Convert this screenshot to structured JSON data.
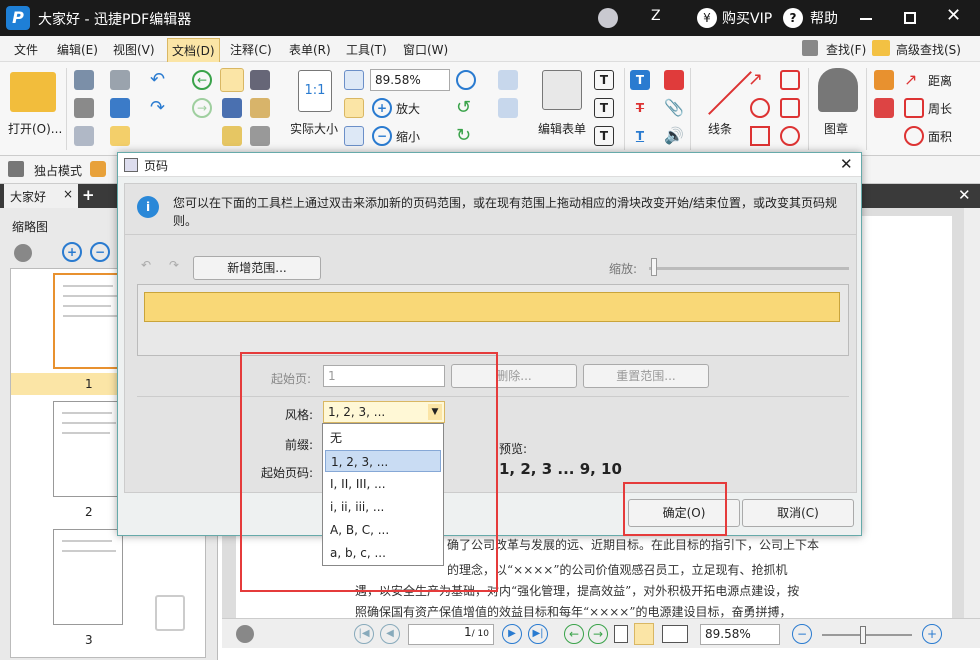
{
  "window": {
    "title": "大家好 - 迅捷PDF编辑器",
    "buy_vip": "购买VIP",
    "help": "帮助",
    "user_initial": "Z"
  },
  "menu": [
    "文件",
    "编辑(E)",
    "视图(V)",
    "文档(D)",
    "注释(C)",
    "表单(R)",
    "工具(T)",
    "窗口(W)"
  ],
  "menu_right": {
    "find": "查找(F)",
    "adv_find": "高级查找(S)"
  },
  "ribbon": {
    "open": "打开(O)...",
    "zoom": "89.58%",
    "actual_size": "实际大小",
    "zoom_in": "放大",
    "zoom_out": "缩小",
    "edit_form": "编辑表单",
    "line": "线条",
    "stamp": "图章",
    "distance": "距离",
    "perimeter": "周长",
    "area": "面积"
  },
  "subbar": {
    "exclusive": "独占模式"
  },
  "tabs": {
    "doc_tab": "大家好"
  },
  "left": {
    "title": "缩略图",
    "pages": [
      "1",
      "2",
      "3"
    ]
  },
  "dialog": {
    "title": "页码",
    "info": "您可以在下面的工具栏上通过双击来添加新的页码范围，或在现有范围上拖动相应的滑块改变开始/结束位置，或改变其页码规",
    "info2": "则。",
    "new_range": "新增范围...",
    "zoom_label": "缩放:",
    "start_page_label": "起始页:",
    "start_page_value": "1",
    "delete": "删除...",
    "reset": "重置范围...",
    "style_label": "风格:",
    "style_value": "1, 2, 3, ...",
    "prefix_label": "前缀:",
    "start_number_label": "起始页码:",
    "preview_label": "预览:",
    "preview_value": "1, 2, 3 ... 9, 10",
    "ok": "确定(O)",
    "cancel": "取消(C)",
    "options": [
      "无",
      "1, 2, 3, ...",
      "I, II, III, ...",
      "i, ii, iii, ...",
      "A, B, C, ...",
      "a, b, c, ..."
    ],
    "selected_option": 1
  },
  "doc_lines": [
    "确了公司改革与发展的远、近期目标。在此目标的指引下，公司上下本",
    "的理念，以“××××”的公司价值观感召员工，立足现有、抢抓机",
    "遇，以安全生产为基础，对内“强化管理，提高效益”，对外积极开拓电源点建设，按",
    "照确保国有资产保值增值的效益目标和每年“××××”的电源建设目标，奋勇拼搏，"
  ],
  "status": {
    "page": "1",
    "total": "/ 10",
    "zoom": "89.58%"
  }
}
